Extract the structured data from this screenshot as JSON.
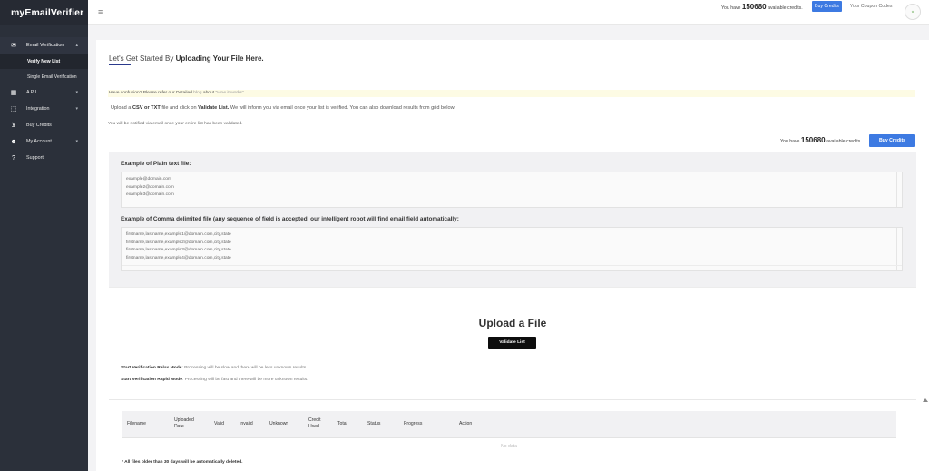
{
  "app": {
    "brand": "myEmailVerifier"
  },
  "sidebar": {
    "items": [
      {
        "label": "Email Verification",
        "icon": "envelope-icon",
        "chevron": "▴"
      },
      {
        "label": "A P I",
        "icon": "api-icon",
        "chevron": "▾"
      },
      {
        "label": "Integration",
        "icon": "puzzle-icon",
        "chevron": "▾"
      },
      {
        "label": "Buy Credits",
        "icon": "cart-icon",
        "chevron": ""
      },
      {
        "label": "My Account",
        "icon": "users-icon",
        "chevron": "▾"
      },
      {
        "label": "Support",
        "icon": "question-icon",
        "chevron": ""
      }
    ],
    "sub_items": [
      {
        "label": "Verify New List"
      },
      {
        "label": "Single Email Verification"
      }
    ]
  },
  "topbar": {
    "credits_prefix": "You have",
    "credits_value": "150680",
    "credits_suffix": "available credits.",
    "buy_label": "Buy Credits",
    "coupon_label": "Your Coupon Codes"
  },
  "main": {
    "title_prefix": "Let's Get Started By",
    "title_bold": "Uploading Your File Here.",
    "notice_text": "Have confusion? Please refer our Detailed",
    "notice_blog": "blog",
    "notice_about": "about",
    "notice_link": "\"How it works\"",
    "upload_desc_1": "Upload a",
    "upload_desc_formats": "CSV or TXT",
    "upload_desc_2": "file and click on",
    "upload_desc_action": "Validate List.",
    "upload_desc_3": "We will inform you via email once your list is verified. You can also download results from grid below.",
    "notify_text": "You will be notified via email once your entire list has been validated.",
    "credits_prefix": "You have",
    "credits_value": "150680",
    "credits_suffix": "available credits.",
    "buy_label": "Buy Credits"
  },
  "examples": {
    "plain_label": "Example of Plain text file:",
    "plain_lines": [
      "example@domain.com",
      "example2@domain.com",
      "example3@domain.com"
    ],
    "csv_label": "Example of Comma delimited file (any sequence of field is accepted, our intelligent robot will find email field automatically:",
    "csv_lines": [
      "firstname,lastname,example1@domain.com,city,state",
      "firstname,lastname,example2@domain.com,city,state",
      "firstname,lastname,example3@domain.com,city,state",
      "firstname,lastname,example4@domain.com,city,state"
    ]
  },
  "upload": {
    "title": "Upload a File",
    "validate_label": "Validate List",
    "relax_title": "Start Verification Relax Mode",
    "relax_desc": ": Processing will be slow and there will be less unknown results.",
    "rapid_title": "Start Verification Rapid Mode",
    "rapid_desc": ": Processing will be fast and there will be more unknown results."
  },
  "table": {
    "columns": [
      {
        "l1": "Filename",
        "l2": ""
      },
      {
        "l1": "Uploaded",
        "l2": "Date"
      },
      {
        "l1": "Valid",
        "l2": ""
      },
      {
        "l1": "Invalid",
        "l2": ""
      },
      {
        "l1": "Unknown",
        "l2": ""
      },
      {
        "l1": "Credit",
        "l2": "Used"
      },
      {
        "l1": "Total",
        "l2": ""
      },
      {
        "l1": "Status",
        "l2": ""
      },
      {
        "l1": "Progress",
        "l2": ""
      },
      {
        "l1": "Action",
        "l2": ""
      }
    ],
    "empty_text": "No data",
    "footnote": "* All files older than 30 days will be automatically deleted."
  },
  "colors": {
    "sidebar": "#2b303a",
    "accent": "#3d7ae2",
    "title_underline": "#2a3a8c"
  }
}
